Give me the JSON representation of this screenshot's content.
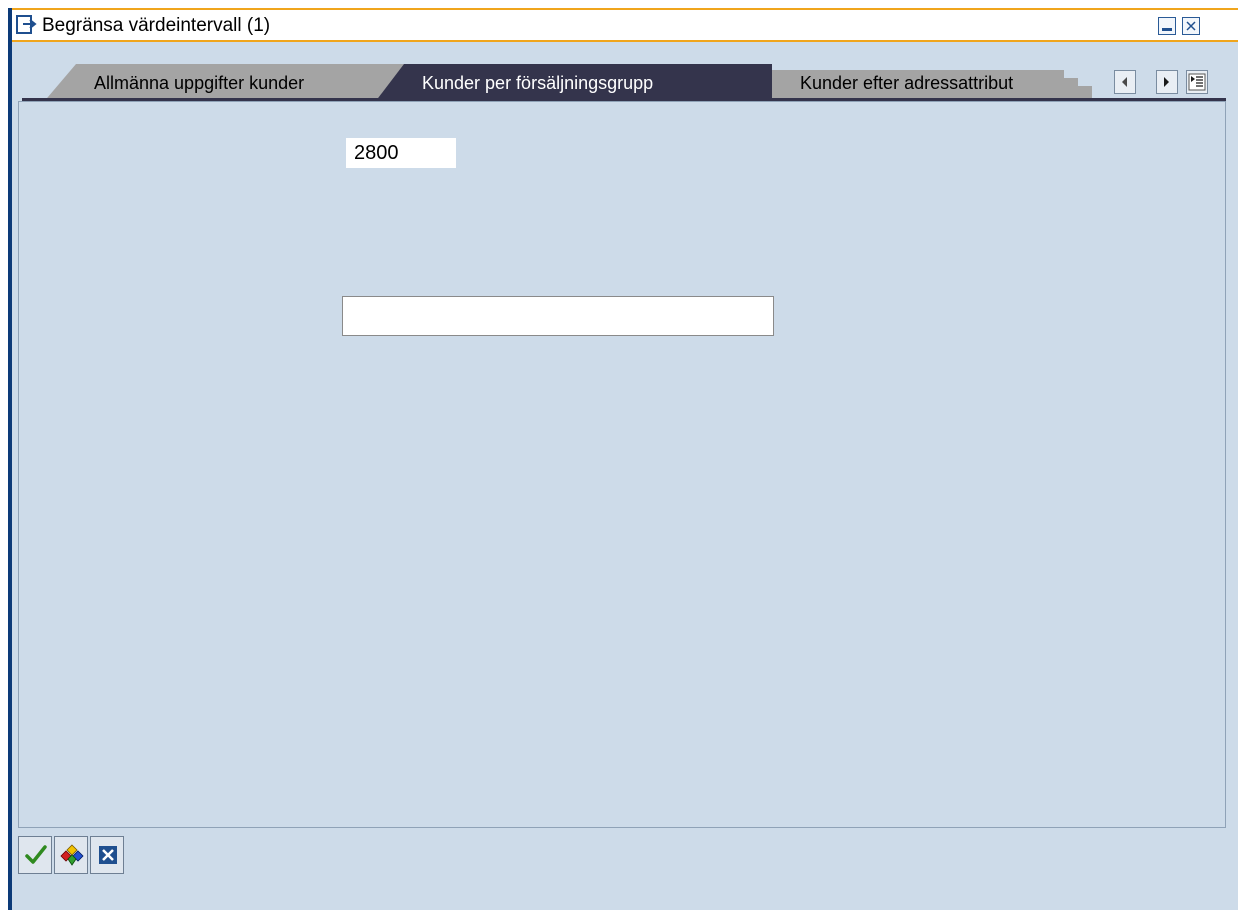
{
  "window": {
    "title": "Begränsa värdeintervall (1)",
    "accent_color": "#f0a51c",
    "frame_color": "#0c3a78",
    "background_color": "#cddbe9"
  },
  "tabs": [
    {
      "label": "Allmänna uppgifter kunder",
      "active": false
    },
    {
      "label": "Kunder per försäljningsgrupp",
      "active": true
    },
    {
      "label": "Kunder efter adressattribut",
      "active": false
    }
  ],
  "tab_nav": {
    "prev_icon": "arrow-left-icon",
    "next_icon": "arrow-right-icon",
    "list_icon": "tab-list-icon"
  },
  "form": {
    "sales_group_value": "2800",
    "description_value": ""
  },
  "toolbar": {
    "confirm_icon": "checkmark-icon",
    "multiple_selection_icon": "multiple-selection-icon",
    "cancel_icon": "cancel-icon"
  }
}
